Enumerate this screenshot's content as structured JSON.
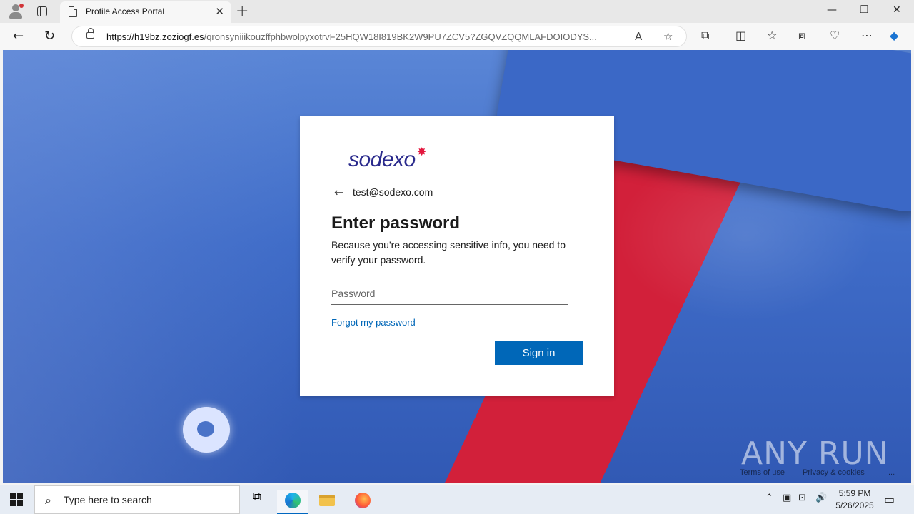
{
  "browser": {
    "tab_title": "Profile Access Portal",
    "url_host": "https://h19bz.zoziogf.es",
    "url_path": "/qronsyniiikouzffphbwolpyxotrvF25HQW18I819BK2W9PU7ZCV5?ZGQVZQQMLAFDOIODYS...",
    "window_controls": [
      "minimize-icon",
      "restore-icon",
      "close-icon"
    ]
  },
  "login": {
    "logo_text": "sodexo",
    "identity": "test@sodexo.com",
    "heading": "Enter password",
    "description": "Because you're accessing sensitive info, you need to verify your password.",
    "password_placeholder": "Password",
    "forgot_link": "Forgot my password",
    "signin_label": "Sign in"
  },
  "footer": {
    "terms": "Terms of use",
    "privacy": "Privacy & cookies",
    "more": "..."
  },
  "watermark": "ANY RUN",
  "taskbar": {
    "search_placeholder": "Type here to search",
    "time": "5:59 PM",
    "date": "5/26/2025"
  },
  "colors": {
    "brand_blue": "#0067b8",
    "logo_blue": "#2a2a8c",
    "logo_red": "#e3173e"
  }
}
